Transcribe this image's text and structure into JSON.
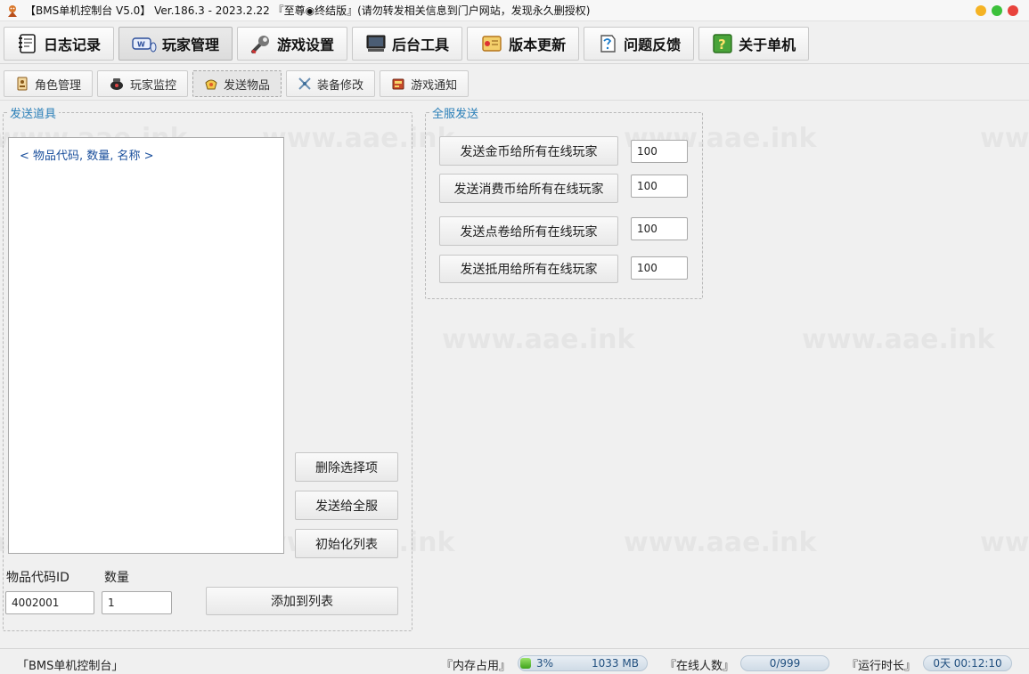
{
  "window": {
    "title": "【BMS单机控制台 V5.0】 Ver.186.3 - 2023.2.22 『至尊◉终结版』(请勿转发相关信息到门户网站，发现永久删授权)",
    "dots": [
      "#f5b324",
      "#3cc13b",
      "#e8433c"
    ]
  },
  "main_tabs": [
    {
      "label": "日志记录",
      "icon": "notebook-icon"
    },
    {
      "label": "玩家管理",
      "icon": "keyboard-mouse-icon"
    },
    {
      "label": "游戏设置",
      "icon": "wrench-icon"
    },
    {
      "label": "后台工具",
      "icon": "monitor-icon"
    },
    {
      "label": "版本更新",
      "icon": "scroll-icon"
    },
    {
      "label": "问题反馈",
      "icon": "feedback-icon"
    },
    {
      "label": "关于单机",
      "icon": "help-icon"
    }
  ],
  "sub_tabs": [
    {
      "label": "角色管理",
      "icon": "character-icon"
    },
    {
      "label": "玩家监控",
      "icon": "monitor-pot-icon"
    },
    {
      "label": "发送物品",
      "icon": "gift-icon"
    },
    {
      "label": "装备修改",
      "icon": "equipment-icon"
    },
    {
      "label": "游戏通知",
      "icon": "notice-icon"
    }
  ],
  "watermark": "www.aae.ink",
  "send_items": {
    "title": "发送道具",
    "list_header": "< 物品代码, 数量, 名称 >",
    "delete_btn": "删除选择项",
    "send_all_btn": "发送给全服",
    "init_list_btn": "初始化列表",
    "code_label": "物品代码ID",
    "qty_label": "数量",
    "code_value": "4002001",
    "qty_value": "1",
    "add_btn": "添加到列表"
  },
  "server_send": {
    "title": "全服发送",
    "rows": [
      {
        "label": "发送金币给所有在线玩家",
        "value": "100"
      },
      {
        "label": "发送消费币给所有在线玩家",
        "value": "100"
      },
      {
        "label": "发送点卷给所有在线玩家",
        "value": "100"
      },
      {
        "label": "发送抵用给所有在线玩家",
        "value": "100"
      }
    ]
  },
  "status": {
    "app": "「BMS单机控制台」",
    "mem_label": "『内存占用』",
    "mem_percent": "3%",
    "mem_size": "1033 MB",
    "mem_fraction": 0.03,
    "online_label": "『在线人数』",
    "online_value": "0/999",
    "runtime_label": "『运行时长』",
    "runtime_value": "0天 00:12:10"
  }
}
